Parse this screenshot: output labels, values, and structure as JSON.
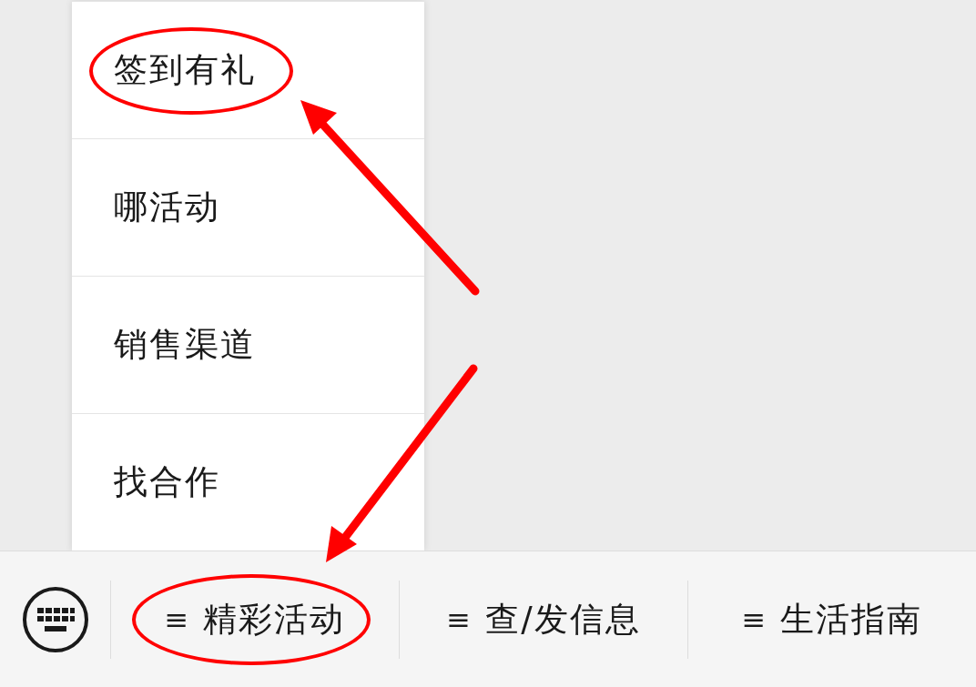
{
  "menu_items": [
    {
      "label": "签到有礼",
      "circled": true
    },
    {
      "label": "哪活动",
      "circled": false
    },
    {
      "label": "销售渠道",
      "circled": false
    },
    {
      "label": "找合作",
      "circled": false
    }
  ],
  "bottom_bar": {
    "menus": [
      {
        "icon": "≡",
        "label": "精彩活动",
        "circled": true
      },
      {
        "icon": "≡",
        "label": "查/发信息",
        "circled": false
      },
      {
        "icon": "≡",
        "label": "生活指南",
        "circled": false
      }
    ]
  }
}
